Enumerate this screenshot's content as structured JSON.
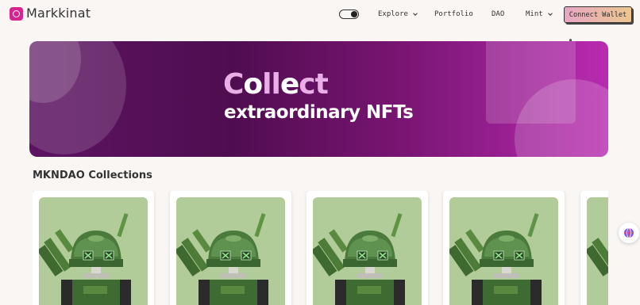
{
  "header": {
    "brand": "Markkinat",
    "nav": {
      "explore": "Explore",
      "portfolio": "Portfolio",
      "dao": "DAO",
      "mint": "Mint"
    },
    "connect_label": "Connect Wallet"
  },
  "hero": {
    "title_parts": [
      "C",
      "o",
      "ll",
      "e",
      "ct"
    ],
    "subtitle": "extraordinary NFTs"
  },
  "collections": {
    "title": "MKNDAO Collections",
    "cards": [
      {
        "image": "robot-nft-image"
      },
      {
        "image": "robot-nft-image"
      },
      {
        "image": "robot-nft-image"
      },
      {
        "image": "robot-nft-image"
      },
      {
        "image": "robot-nft-image"
      }
    ]
  },
  "colors": {
    "accent": "#d6258f",
    "banner_start": "#5d1462",
    "banner_end": "#b82bb0",
    "card_bg": "#b1cc98"
  }
}
